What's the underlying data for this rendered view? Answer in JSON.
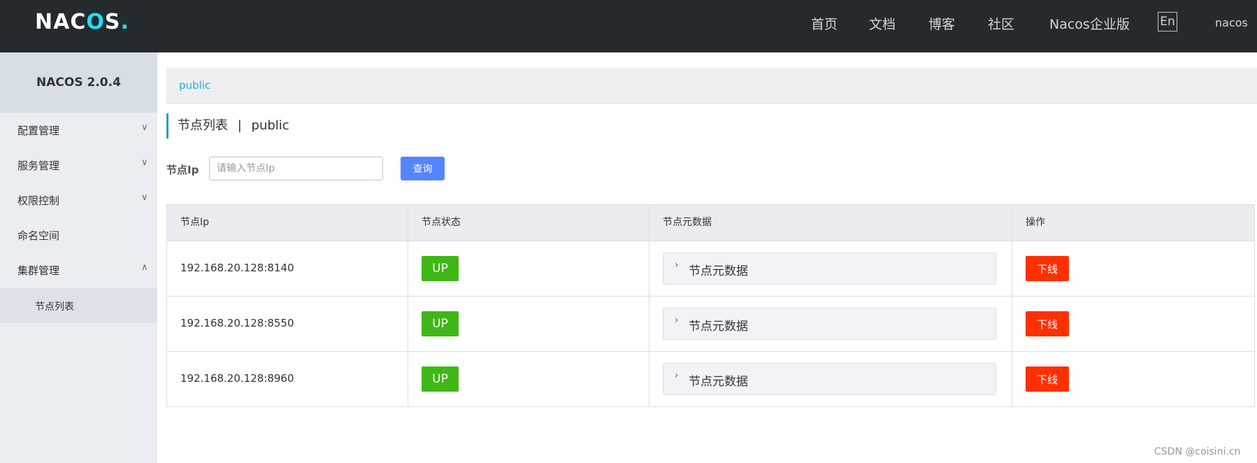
{
  "app": {
    "logo_text_n": "N",
    "logo_text_a": "A",
    "logo_text_c": "C",
    "logo_text_o": "O",
    "logo_text_s": "S",
    "logo_text_dot": "."
  },
  "topnav": {
    "items": [
      "首页",
      "文档",
      "博客",
      "社区",
      "Nacos企业版"
    ],
    "lang": "En",
    "user": "nacos"
  },
  "sidebar": {
    "title": "NACOS 2.0.4",
    "items": [
      {
        "label": "配置管理",
        "arrow": "∨"
      },
      {
        "label": "服务管理",
        "arrow": "∨"
      },
      {
        "label": "权限控制",
        "arrow": "∨"
      },
      {
        "label": "命名空间",
        "arrow": ""
      },
      {
        "label": "集群管理",
        "arrow": "∧"
      }
    ],
    "sub_item": "节点列表"
  },
  "breadcrumb": {
    "namespace": "public"
  },
  "page": {
    "title": "节点列表",
    "separator": "|",
    "namespace": "public"
  },
  "search": {
    "label": "节点Ip",
    "placeholder": "请输入节点Ip",
    "value": "",
    "button": "查询"
  },
  "table": {
    "headers": [
      "节点Ip",
      "节点状态",
      "节点元数据",
      "操作"
    ],
    "rows": [
      {
        "ip": "192.168.20.128:8140",
        "status": "UP",
        "meta": "节点元数据",
        "action": "下线"
      },
      {
        "ip": "192.168.20.128:8550",
        "status": "UP",
        "meta": "节点元数据",
        "action": "下线"
      },
      {
        "ip": "192.168.20.128:8960",
        "status": "UP",
        "meta": "节点元数据",
        "action": "下线"
      }
    ]
  },
  "watermark": "CSDN @coisini.cn",
  "colors": {
    "topbar": "#252a2f",
    "accent": "#1ab3d1",
    "primary_button": "#5584ff",
    "status_up": "#3fb716",
    "danger": "#ff3000"
  },
  "icons": {
    "chevron_right": "›"
  }
}
